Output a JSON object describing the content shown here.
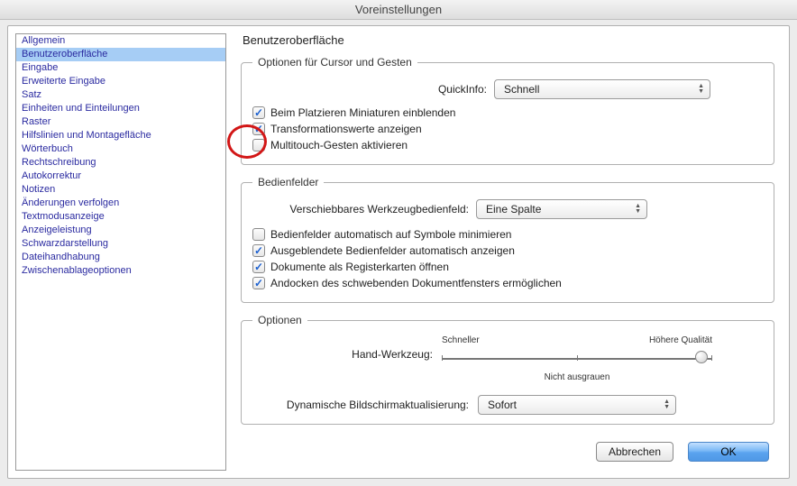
{
  "window": {
    "title": "Voreinstellungen"
  },
  "sidebar": {
    "items": [
      "Allgemein",
      "Benutzeroberfläche",
      "Eingabe",
      "Erweiterte Eingabe",
      "Satz",
      "Einheiten und Einteilungen",
      "Raster",
      "Hilfslinien und Montagefläche",
      "Wörterbuch",
      "Rechtschreibung",
      "Autokorrektur",
      "Notizen",
      "Änderungen verfolgen",
      "Textmodusanzeige",
      "Anzeigeleistung",
      "Schwarzdarstellung",
      "Dateihandhabung",
      "Zwischenablageoptionen"
    ],
    "selected_index": 1
  },
  "main": {
    "title": "Benutzeroberfläche",
    "group1": {
      "legend": "Optionen für Cursor und Gesten",
      "quickinfo_label": "QuickInfo:",
      "quickinfo_value": "Schnell",
      "cb1": {
        "checked": true,
        "label": "Beim Platzieren Miniaturen einblenden"
      },
      "cb2": {
        "checked": true,
        "label": "Transformationswerte anzeigen"
      },
      "cb3": {
        "checked": false,
        "label": "Multitouch-Gesten aktivieren"
      }
    },
    "group2": {
      "legend": "Bedienfelder",
      "toolpanel_label": "Verschiebbares Werkzeugbedienfeld:",
      "toolpanel_value": "Eine Spalte",
      "cb1": {
        "checked": false,
        "label": "Bedienfelder automatisch auf Symbole minimieren"
      },
      "cb2": {
        "checked": true,
        "label": "Ausgeblendete Bedienfelder automatisch anzeigen"
      },
      "cb3": {
        "checked": true,
        "label": "Dokumente als Registerkarten öffnen"
      },
      "cb4": {
        "checked": true,
        "label": "Andocken des schwebenden Dokumentfensters ermöglichen"
      }
    },
    "group3": {
      "legend": "Optionen",
      "slider_left": "Schneller",
      "slider_right": "Höhere Qualität",
      "hand_label": "Hand-Werkzeug:",
      "slider_mid": "Nicht ausgrauen",
      "slider_pos_pct": 96,
      "dyn_label": "Dynamische Bildschirmaktualisierung:",
      "dyn_value": "Sofort"
    }
  },
  "buttons": {
    "cancel": "Abbrechen",
    "ok": "OK"
  }
}
